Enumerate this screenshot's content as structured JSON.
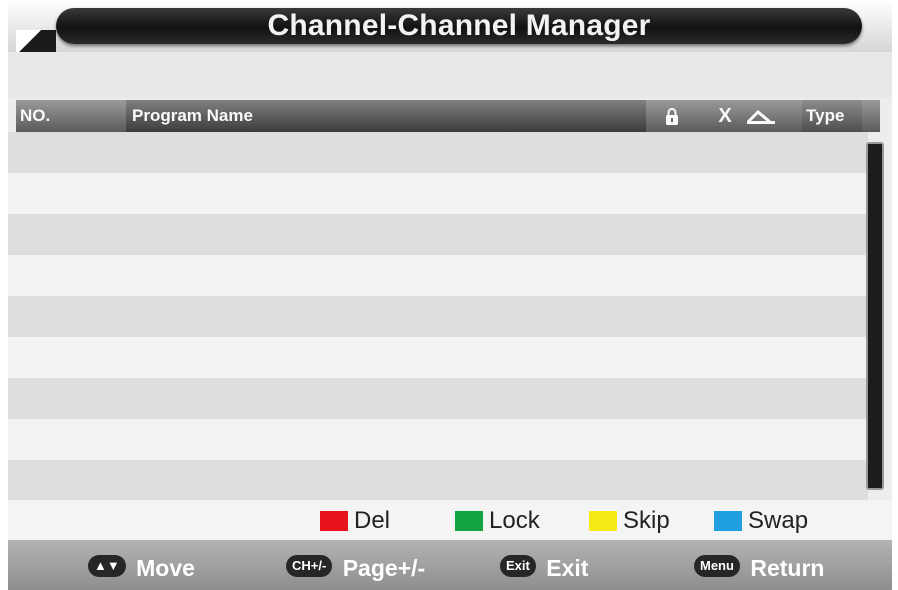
{
  "title": "Channel-Channel Manager",
  "columns": {
    "no": "NO.",
    "program_name": "Program Name",
    "lock_icon": "lock-icon",
    "delete": "X",
    "skip_icon": "skip-icon",
    "type": "Type"
  },
  "list": {
    "row_count": 9,
    "rows": []
  },
  "legend": [
    {
      "label": "Del",
      "color": "#e8141b"
    },
    {
      "label": "Lock",
      "color": "#10a33f"
    },
    {
      "label": "Skip",
      "color": "#f6ea16"
    },
    {
      "label": "Swap",
      "color": "#1ea0e2"
    }
  ],
  "footer": [
    {
      "key": "▲▼",
      "label": "Move"
    },
    {
      "key": "CH+/-",
      "label": "Page+/-"
    },
    {
      "key": "Exit",
      "label": "Exit"
    },
    {
      "key": "Menu",
      "label": "Return"
    }
  ]
}
